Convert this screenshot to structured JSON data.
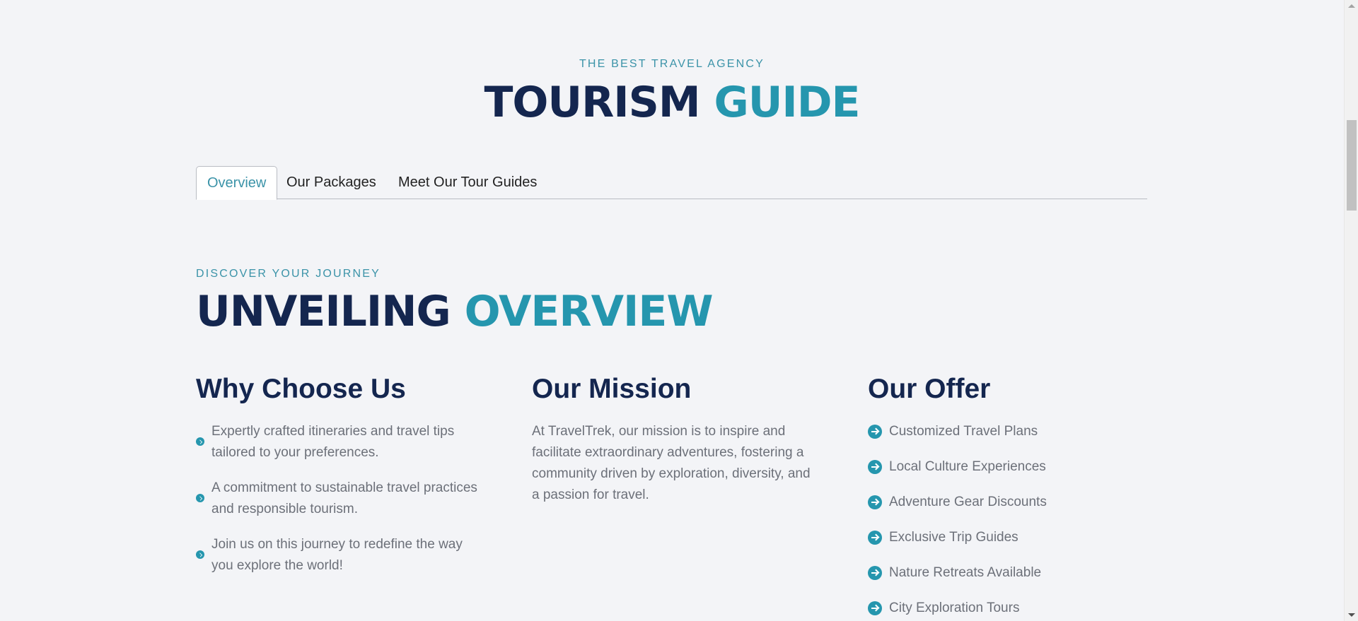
{
  "header": {
    "eyebrow": "THE BEST TRAVEL AGENCY",
    "title_main": "TOURISM",
    "title_accent": "GUIDE"
  },
  "tabs": [
    {
      "label": "Overview",
      "active": true
    },
    {
      "label": "Our Packages",
      "active": false
    },
    {
      "label": "Meet Our Tour Guides",
      "active": false
    }
  ],
  "overview": {
    "eyebrow": "DISCOVER YOUR JOURNEY",
    "title_main": "UNVEILING",
    "title_accent": "OVERVIEW"
  },
  "why": {
    "heading": "Why Choose Us",
    "items": [
      "Expertly crafted itineraries and travel tips tailored to your preferences.",
      "A commitment to sustainable travel practices and responsible tourism.",
      "Join us on this journey to redefine the way you explore the world!"
    ]
  },
  "mission": {
    "heading": "Our Mission",
    "text": "At TravelTrek, our mission is to inspire and facilitate extraordinary adventures, fostering a community driven by exploration, diversity, and a passion for travel."
  },
  "offer": {
    "heading": "Our Offer",
    "items": [
      "Customized Travel Plans",
      "Local Culture Experiences",
      "Adventure Gear Discounts",
      "Exclusive Trip Guides",
      "Nature Retreats Available",
      "City Exploration Tours"
    ]
  },
  "colors": {
    "navy": "#14264f",
    "accent": "#2596ae",
    "muted_text": "#6c7079",
    "background": "#f3f4f7"
  },
  "icons": {
    "list_bullet": "arrow-circle-icon"
  }
}
